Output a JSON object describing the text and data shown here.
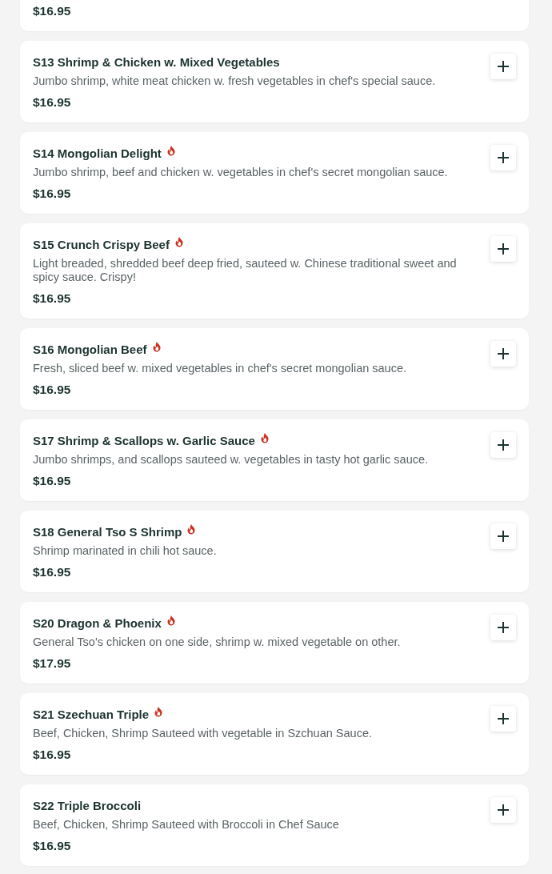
{
  "items": [
    {
      "price": "$16.95"
    },
    {
      "name": "S13 Shrimp & Chicken w. Mixed Vegetables",
      "spicy": false,
      "description": "Jumbo shrimp, white meat chicken w. fresh vegetables in chef's special sauce.",
      "price": "$16.95"
    },
    {
      "name": "S14 Mongolian Delight",
      "spicy": true,
      "description": "Jumbo shrimp, beef and chicken w. vegetables in chef's secret mongolian sauce.",
      "price": "$16.95"
    },
    {
      "name": "S15 Crunch Crispy Beef",
      "spicy": true,
      "description": "Light breaded, shredded beef deep fried, sauteed w. Chinese traditional sweet and spicy sauce. Crispy!",
      "price": "$16.95"
    },
    {
      "name": "S16 Mongolian Beef",
      "spicy": true,
      "description": "Fresh, sliced beef w. mixed vegetables in chef's secret mongolian sauce.",
      "price": "$16.95"
    },
    {
      "name": "S17 Shrimp & Scallops w. Garlic Sauce",
      "spicy": true,
      "description": "Jumbo shrimps, and scallops sauteed w. vegetables in tasty hot garlic sauce.",
      "price": "$16.95"
    },
    {
      "name": "S18 General Tso S Shrimp",
      "spicy": true,
      "description": "Shrimp marinated in chili hot sauce.",
      "price": "$16.95"
    },
    {
      "name": "S20 Dragon & Phoenix",
      "spicy": true,
      "description": "General Tso's chicken on one side, shrimp w. mixed vegetable on other.",
      "price": "$17.95"
    },
    {
      "name": "S21 Szechuan Triple",
      "spicy": true,
      "description": "Beef, Chicken, Shrimp Sauteed with vegetable in Szchuan Sauce.",
      "price": "$16.95"
    },
    {
      "name": "S22 Triple Broccoli",
      "spicy": false,
      "description": "Beef, Chicken, Shrimp Sauteed with Broccoli in Chef Sauce",
      "price": "$16.95"
    }
  ]
}
